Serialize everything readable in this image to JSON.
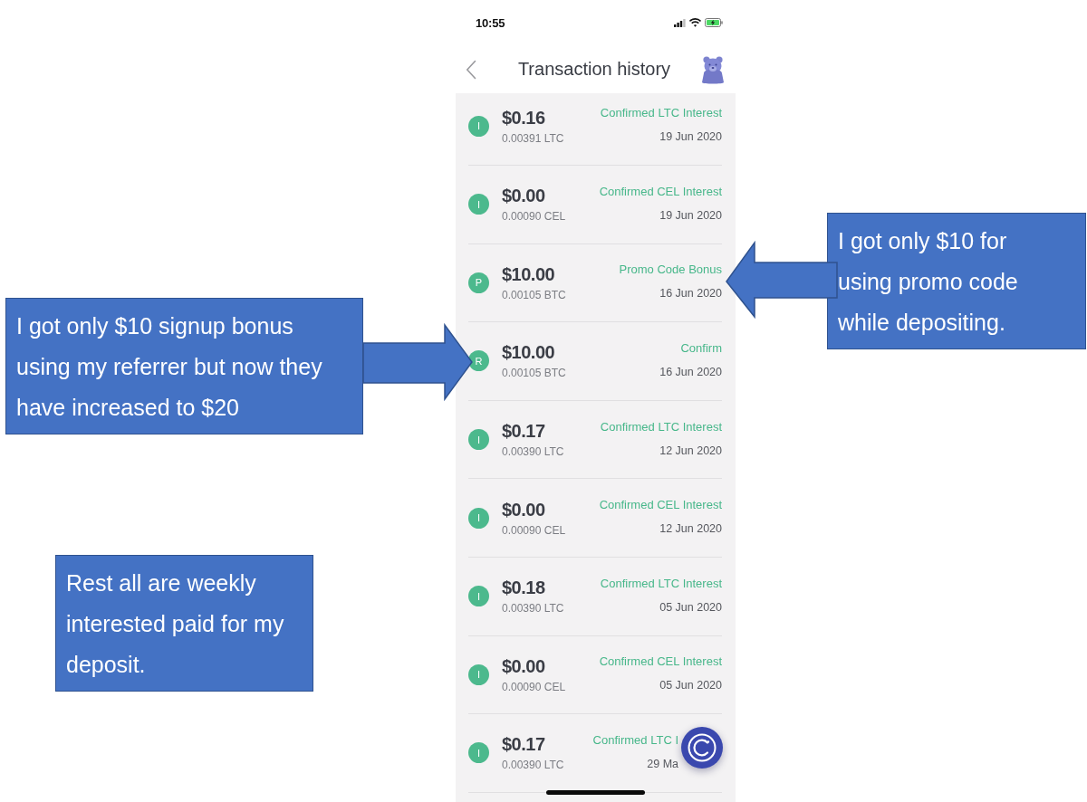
{
  "status_bar": {
    "time": "10:55"
  },
  "header": {
    "title": "Transaction history"
  },
  "transactions": [
    {
      "badge": "I",
      "amount": "$0.16",
      "crypto_amount": "0.00391 LTC",
      "status": "Confirmed LTC Interest",
      "date": "19 Jun 2020"
    },
    {
      "badge": "I",
      "amount": "$0.00",
      "crypto_amount": "0.00090 CEL",
      "status": "Confirmed CEL Interest",
      "date": "19 Jun 2020"
    },
    {
      "badge": "P",
      "amount": "$10.00",
      "crypto_amount": "0.00105 BTC",
      "status": "Promo Code Bonus",
      "date": "16 Jun 2020"
    },
    {
      "badge": "R",
      "amount": "$10.00",
      "crypto_amount": "0.00105 BTC",
      "status": "Confirm",
      "date": "16 Jun 2020"
    },
    {
      "badge": "I",
      "amount": "$0.17",
      "crypto_amount": "0.00390 LTC",
      "status": "Confirmed LTC Interest",
      "date": "12 Jun 2020"
    },
    {
      "badge": "I",
      "amount": "$0.00",
      "crypto_amount": "0.00090 CEL",
      "status": "Confirmed CEL Interest",
      "date": "12 Jun 2020"
    },
    {
      "badge": "I",
      "amount": "$0.18",
      "crypto_amount": "0.00390 LTC",
      "status": "Confirmed LTC Interest",
      "date": "05 Jun 2020"
    },
    {
      "badge": "I",
      "amount": "$0.00",
      "crypto_amount": "0.00090 CEL",
      "status": "Confirmed CEL Interest",
      "date": "05 Jun 2020"
    },
    {
      "badge": "I",
      "amount": "$0.17",
      "crypto_amount": "0.00390 LTC",
      "status": "Confirmed LTC I",
      "date": "29 Ma"
    }
  ],
  "annotations": [
    {
      "kind": "left",
      "text": "I got only $10 for\nusing promo code\nwhile depositing."
    },
    {
      "kind": "right",
      "text": "I got only $10 signup bonus\nusing my referrer but now they\nhave increased to $20"
    },
    {
      "kind": "plain",
      "text": "Rest all are weekly\ninterested paid for my\ndeposit."
    }
  ]
}
